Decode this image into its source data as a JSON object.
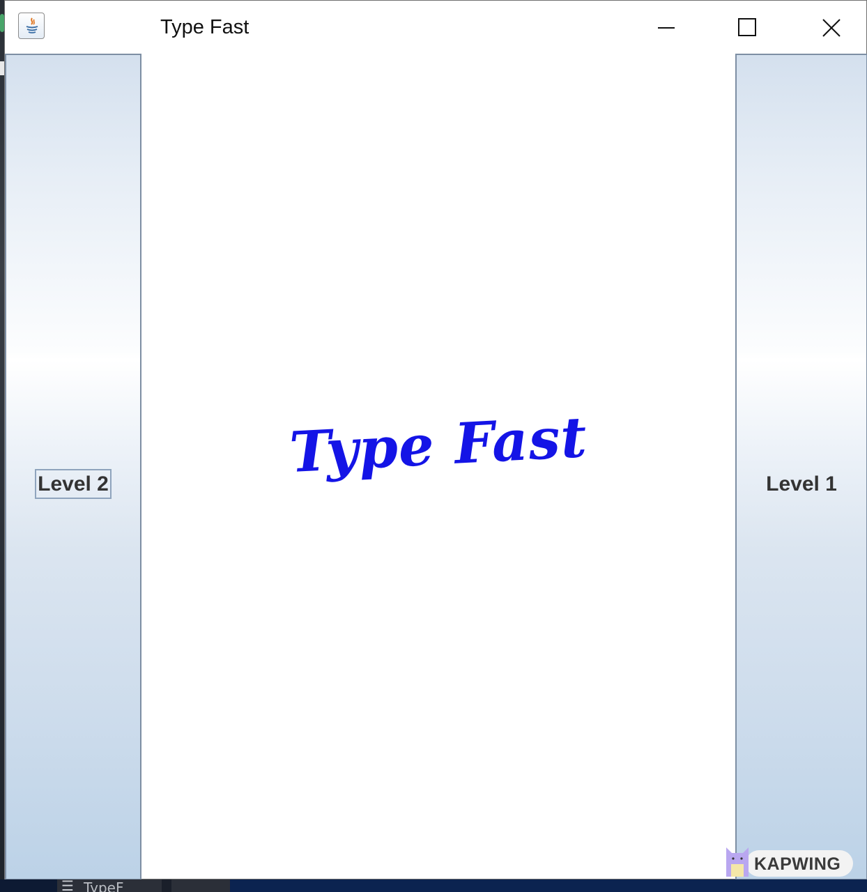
{
  "window": {
    "title": "Type Fast"
  },
  "buttons": {
    "left_label": "Level 2",
    "right_label": "Level 1"
  },
  "main": {
    "heading": "Type Fast",
    "heading_color": "#1414e6"
  },
  "taskbar": {
    "task_label": "TypeF"
  },
  "watermark": {
    "text": "KAPWING"
  }
}
